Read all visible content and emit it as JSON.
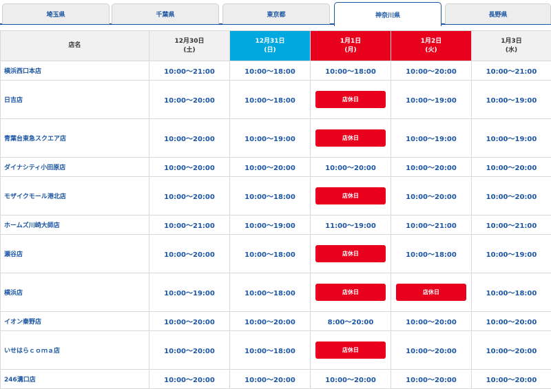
{
  "tabs": [
    "埼玉県",
    "千葉県",
    "東京都",
    "神奈川県",
    "長野県"
  ],
  "header": {
    "store": "店名",
    "days": [
      {
        "date": "12月30日",
        "dow": "(土)"
      },
      {
        "date": "12月31日",
        "dow": "(日)"
      },
      {
        "date": "1月1日",
        "dow": "(月)"
      },
      {
        "date": "1月2日",
        "dow": "(火)"
      },
      {
        "date": "1月3日",
        "dow": "(水)"
      }
    ]
  },
  "closed_label": "店休日",
  "rows": [
    {
      "name": "横浜西口本店",
      "h": [
        "10:00～21:00",
        "10:00～18:00",
        "10:00～18:00",
        "10:00～20:00",
        "10:00～21:00"
      ]
    },
    {
      "name": "日吉店",
      "h": [
        "10:00～20:00",
        "10:00～18:00",
        "店休日",
        "10:00～19:00",
        "10:00～19:00"
      ]
    },
    {
      "name": "青葉台東急スクエア店",
      "h": [
        "10:00～20:00",
        "10:00～19:00",
        "店休日",
        "10:00～19:00",
        "10:00～19:00"
      ]
    },
    {
      "name": "ダイナシティ小田原店",
      "h": [
        "10:00～20:00",
        "10:00～20:00",
        "10:00～20:00",
        "10:00～20:00",
        "10:00～20:00"
      ]
    },
    {
      "name": "モザイクモール港北店",
      "h": [
        "10:00～20:00",
        "10:00～18:00",
        "店休日",
        "10:00～20:00",
        "10:00～20:00"
      ]
    },
    {
      "name": "ホームズ川崎大師店",
      "h": [
        "10:00～21:00",
        "10:00～19:00",
        "11:00～19:00",
        "10:00～21:00",
        "10:00～21:00"
      ]
    },
    {
      "name": "瀬谷店",
      "h": [
        "10:00～20:00",
        "10:00～18:00",
        "店休日",
        "10:00～18:00",
        "10:00～19:00"
      ]
    },
    {
      "name": "横浜店",
      "h": [
        "10:00～19:00",
        "10:00～18:00",
        "店休日",
        "店休日",
        "10:00～18:00"
      ]
    },
    {
      "name": "イオン秦野店",
      "h": [
        "10:00～20:00",
        "10:00～20:00",
        "8:00～20:00",
        "10:00～20:00",
        "10:00～20:00"
      ]
    },
    {
      "name": "いせはらｃｏｍａ店",
      "h": [
        "10:00～20:00",
        "10:00～18:00",
        "店休日",
        "10:00～20:00",
        "10:00～20:00"
      ]
    },
    {
      "name": "246溝口店",
      "h": [
        "10:00～20:00",
        "10:00～20:00",
        "10:00～20:00",
        "10:00～20:00",
        "10:00～20:00"
      ]
    }
  ]
}
